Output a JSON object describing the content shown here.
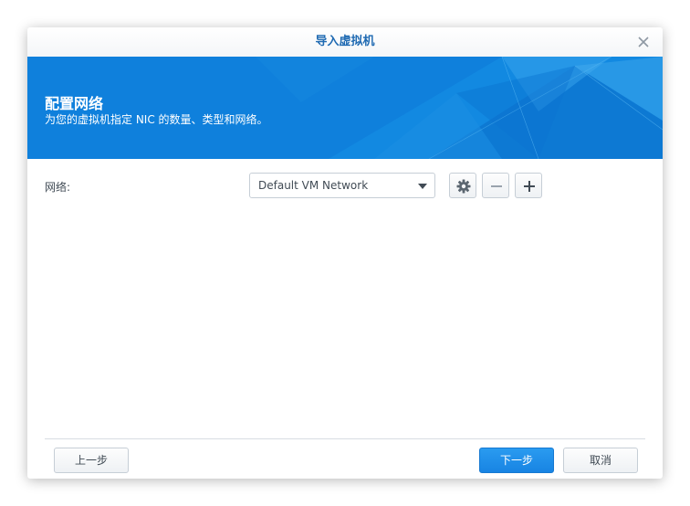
{
  "window": {
    "title": "导入虚拟机"
  },
  "banner": {
    "heading": "配置网络",
    "subheading": "为您的虚拟机指定 NIC 的数量、类型和网络。"
  },
  "network": {
    "label": "网络:",
    "selected_value": "Default VM Network"
  },
  "icons": {
    "close": "close-icon",
    "settings": "gear-icon",
    "remove": "minus-icon",
    "add": "plus-icon",
    "dropdown": "caret-down-icon"
  },
  "footer": {
    "prev_label": "上一步",
    "next_label": "下一步",
    "cancel_label": "取消"
  },
  "colors": {
    "accent": "#0f80dc",
    "title_text": "#1f6ab2",
    "primary_button": "#1884e3"
  }
}
